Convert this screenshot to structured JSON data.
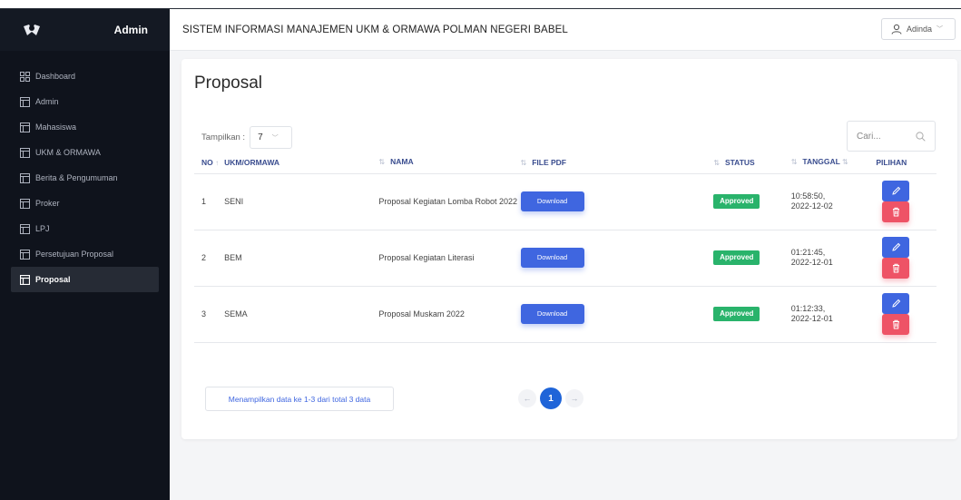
{
  "sidebar": {
    "brand": "Admin",
    "items": [
      {
        "label": "Dashboard",
        "icon": "grid-icon"
      },
      {
        "label": "Admin",
        "icon": "table-icon"
      },
      {
        "label": "Mahasiswa",
        "icon": "table-icon"
      },
      {
        "label": "UKM & ORMAWA",
        "icon": "table-icon"
      },
      {
        "label": "Berita & Pengumuman",
        "icon": "table-icon"
      },
      {
        "label": "Proker",
        "icon": "table-icon"
      },
      {
        "label": "LPJ",
        "icon": "table-icon"
      },
      {
        "label": "Persetujuan Proposal",
        "icon": "table-icon"
      },
      {
        "label": "Proposal",
        "icon": "table-icon",
        "active": true
      }
    ]
  },
  "header": {
    "title": "SISTEM INFORMASI MANAJEMEN UKM & ORMAWA POLMAN NEGERI BABEL",
    "user": "Adinda"
  },
  "page": {
    "title": "Proposal",
    "show_label": "Tampilkan :",
    "show_value": "7",
    "search_placeholder": "Cari..."
  },
  "table": {
    "columns": [
      "NO",
      "UKM/ORMAWA",
      "NAMA",
      "FILE PDF",
      "STATUS",
      "TANGGAL",
      "PILIHAN"
    ],
    "rows": [
      {
        "no": "1",
        "ukm": "SENI",
        "nama": "Proposal Kegiatan Lomba Robot 2022",
        "file": "Download",
        "status": "Approved",
        "time": "10:58:50,",
        "date": "2022-12-02"
      },
      {
        "no": "2",
        "ukm": "BEM",
        "nama": "Proposal Kegiatan Literasi",
        "file": "Download",
        "status": "Approved",
        "time": "01:21:45,",
        "date": "2022-12-01"
      },
      {
        "no": "3",
        "ukm": "SEMA",
        "nama": "Proposal Muskam 2022",
        "file": "Download",
        "status": "Approved",
        "time": "01:12:33,",
        "date": "2022-12-01"
      }
    ]
  },
  "footer": {
    "info": "Menampilkan data ke 1-3 dari total 3 data",
    "prev": "←",
    "next": "→",
    "current_page": "1"
  },
  "colors": {
    "primary": "#3f66e0",
    "danger": "#ee5366",
    "success": "#29b36b",
    "sidebar": "#0f131c"
  }
}
